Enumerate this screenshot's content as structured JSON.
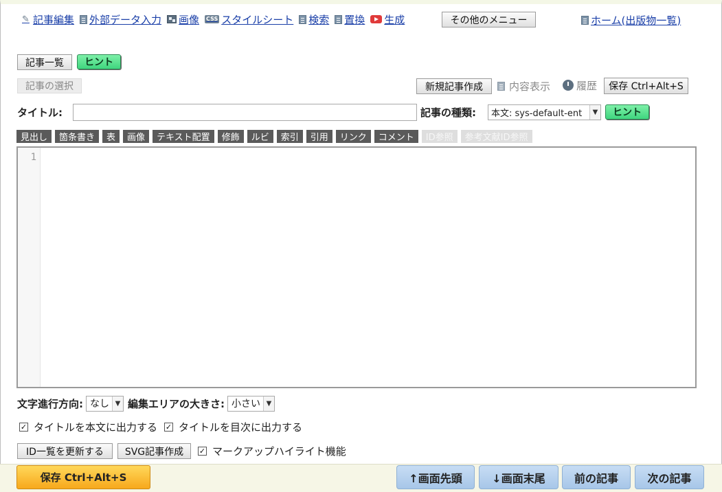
{
  "nav": {
    "items": [
      {
        "label": "記事編集",
        "icon": "pencil-icon"
      },
      {
        "label": "外部データ入力",
        "icon": "document-icon"
      },
      {
        "label": "画像",
        "icon": "image-icon"
      },
      {
        "label": "スタイルシート",
        "icon": "css-icon"
      },
      {
        "label": "検索",
        "icon": "document-icon"
      },
      {
        "label": "置換",
        "icon": "document-icon"
      },
      {
        "label": "生成",
        "icon": "play-icon"
      }
    ],
    "other_menu": "その他のメニュー",
    "home": "ホーム(出版物一覧)"
  },
  "article_list_button": "記事一覧",
  "hint_label": "ヒント",
  "select_article": "記事の選択",
  "new_article": "新規記事作成",
  "show_content": "内容表示",
  "history": "履歴",
  "save_top": "保存 Ctrl+Alt+S",
  "title_label": "タイトル:",
  "title_value": "",
  "kind_label": "記事の種類:",
  "kind_value": "本文: sys-default-ent",
  "toolbar": [
    {
      "label": "見出し",
      "enabled": true
    },
    {
      "label": "箇条書き",
      "enabled": true
    },
    {
      "label": "表",
      "enabled": true
    },
    {
      "label": "画像",
      "enabled": true
    },
    {
      "label": "テキスト配置",
      "enabled": true
    },
    {
      "label": "修飾",
      "enabled": true
    },
    {
      "label": "ルビ",
      "enabled": true
    },
    {
      "label": "索引",
      "enabled": true
    },
    {
      "label": "引用",
      "enabled": true
    },
    {
      "label": "リンク",
      "enabled": true
    },
    {
      "label": "コメント",
      "enabled": true
    },
    {
      "label": "ID参照",
      "enabled": false
    },
    {
      "label": "参考文献ID参照",
      "enabled": false
    }
  ],
  "editor": {
    "line_number": "1",
    "content": ""
  },
  "text_direction_label": "文字進行方向:",
  "text_direction_value": "なし",
  "editor_size_label": "編集エリアの大きさ:",
  "editor_size_value": "小さい",
  "checkbox_title_body": {
    "label": "タイトルを本文に出力する",
    "checked": true
  },
  "checkbox_title_toc": {
    "label": "タイトルを目次に出力する",
    "checked": true
  },
  "id_update": "ID一覧を更新する",
  "svg_create": "SVG記事作成",
  "checkbox_markup": {
    "label": "マークアップハイライト機能",
    "checked": true
  },
  "bottom": {
    "save": "保存 Ctrl+Alt+S",
    "top": "↑画面先頭",
    "bottom": "↓画面末尾",
    "prev": "前の記事",
    "next": "次の記事"
  }
}
